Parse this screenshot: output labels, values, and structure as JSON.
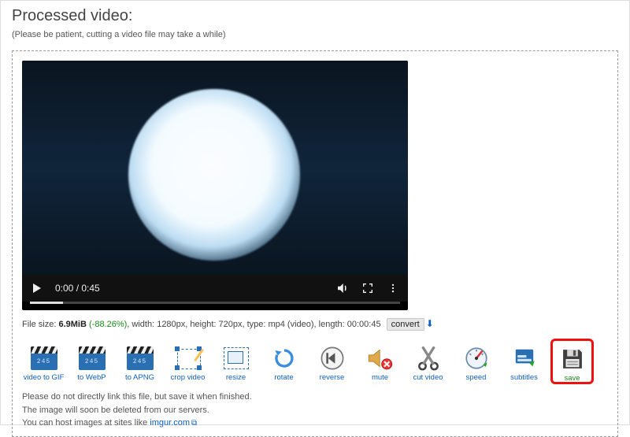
{
  "header": {
    "title": "Processed video:",
    "subtitle": "(Please be patient, cutting a video file may take a while)"
  },
  "player": {
    "current_time": "0:00",
    "duration": "0:45",
    "time_display": "0:00 / 0:45"
  },
  "meta": {
    "label_filesize": "File size: ",
    "filesize": "6.9MiB",
    "pct": " (-88.26%)",
    "rest": ", width: 1280px, height: 720px, type: mp4 (video), length: 00:00:45",
    "convert_label": "convert"
  },
  "tools": {
    "to_gif": "video to GIF",
    "to_webp": "to WebP",
    "to_apng": "to APNG",
    "crop": "crop video",
    "resize": "resize",
    "rotate": "rotate",
    "reverse": "reverse",
    "mute": "mute",
    "cut": "cut video",
    "speed": "speed",
    "subtitles": "subtitles",
    "save": "save"
  },
  "notes": {
    "line1": "Please do not directly link this file, but save it when finished.",
    "line2": "The image will soon be deleted from our servers.",
    "line3_prefix": "You can host images at sites like ",
    "line3_link": "imgur.com"
  }
}
